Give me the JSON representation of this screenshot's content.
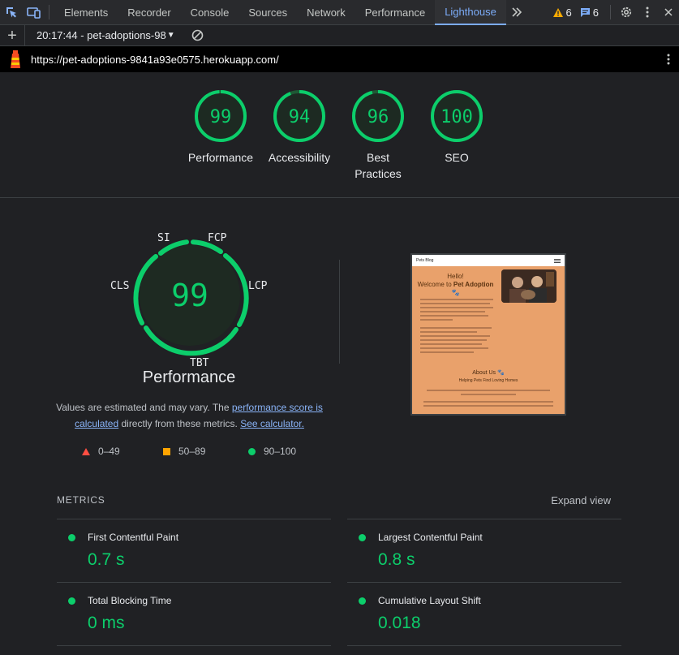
{
  "devtools": {
    "tabs": [
      "Elements",
      "Recorder",
      "Console",
      "Sources",
      "Network",
      "Performance",
      "Lighthouse"
    ],
    "active_tab": "Lighthouse",
    "warnings_count": "6",
    "messages_count": "6"
  },
  "toolbar": {
    "report_selector": "20:17:44 - pet-adoptions-98"
  },
  "url": "https://pet-adoptions-9841a93e0575.herokuapp.com/",
  "scores": [
    {
      "value": "99",
      "label": "Performance"
    },
    {
      "value": "94",
      "label": "Accessibility"
    },
    {
      "value": "96",
      "label": "Best Practices"
    },
    {
      "value": "100",
      "label": "SEO"
    }
  ],
  "performance": {
    "score": "99",
    "title": "Performance",
    "gauge_labels": {
      "si": "SI",
      "fcp": "FCP",
      "lcp": "LCP",
      "tbt": "TBT",
      "cls": "CLS"
    },
    "desc_pre": "Values are estimated and may vary. The ",
    "desc_link1": "performance score is calculated",
    "desc_mid": " directly from these metrics. ",
    "desc_link2": "See calculator."
  },
  "legend": {
    "fail": "0–49",
    "average": "50–89",
    "pass": "90–100"
  },
  "thumbnail": {
    "brand": "Pets Blog",
    "hello": "Hello!",
    "welcome": "Welcome to",
    "site": "Pet Adoption",
    "about": "About Us",
    "about_sub": "Helping Pets Find Loving Homes"
  },
  "metrics": {
    "heading": "METRICS",
    "expand_label": "Expand view",
    "items": [
      {
        "title": "First Contentful Paint",
        "value": "0.7 s"
      },
      {
        "title": "Largest Contentful Paint",
        "value": "0.8 s"
      },
      {
        "title": "Total Blocking Time",
        "value": "0 ms"
      },
      {
        "title": "Cumulative Layout Shift",
        "value": "0.018"
      }
    ]
  },
  "colors": {
    "pass": "#0cce6b",
    "average": "#ffa400",
    "fail": "#ff4e42",
    "link": "#8ab4f8",
    "active_tab": "#7cacf8"
  },
  "icons": [
    "inspect-icon",
    "device-toolbar-icon",
    "more-tabs-icon",
    "warning-icon",
    "message-icon",
    "settings-icon",
    "kebab-menu-icon",
    "plus-icon",
    "clear-icon",
    "lighthouse-logo"
  ]
}
